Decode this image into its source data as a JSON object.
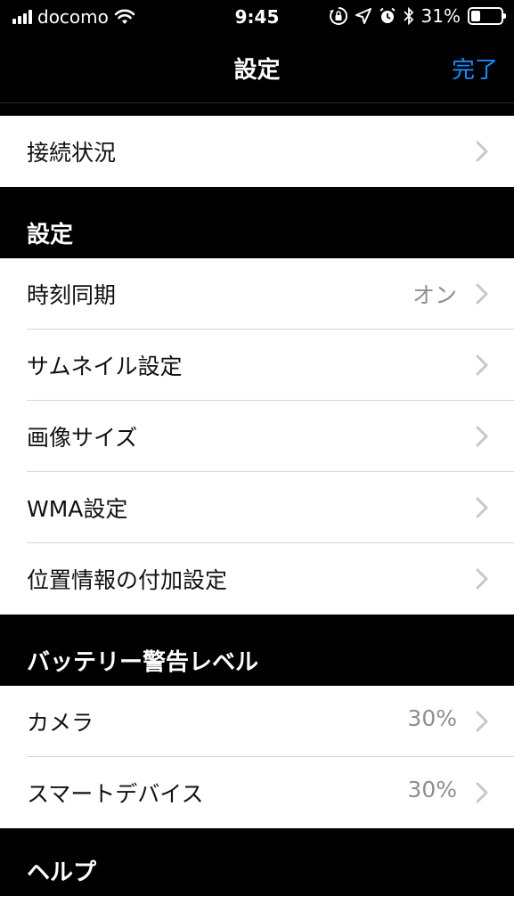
{
  "status_bar": {
    "carrier": "docomo",
    "time": "9:45",
    "battery_percent_label": "31%",
    "battery_level": 0.31
  },
  "nav": {
    "title": "設定",
    "done_label": "完了"
  },
  "sections": {
    "connection": {
      "items": [
        {
          "label": "接続状況",
          "value": ""
        }
      ]
    },
    "settings": {
      "header": "設定",
      "items": [
        {
          "label": "時刻同期",
          "value": "オン"
        },
        {
          "label": "サムネイル設定",
          "value": ""
        },
        {
          "label": "画像サイズ",
          "value": ""
        },
        {
          "label": "WMA設定",
          "value": ""
        },
        {
          "label": "位置情報の付加設定",
          "value": ""
        }
      ]
    },
    "battery_warning": {
      "header": "バッテリー警告レベル",
      "items": [
        {
          "label": "カメラ",
          "value": "30%"
        },
        {
          "label": "スマートデバイス",
          "value": "30%"
        }
      ]
    },
    "help": {
      "header": "ヘルプ"
    }
  },
  "colors": {
    "background": "#000000",
    "row_background": "#ffffff",
    "accent": "#1a8cff",
    "secondary_text": "#8e8e93",
    "chevron": "#c7c7cc"
  },
  "icons": [
    "wifi-icon",
    "orientation-lock-icon",
    "location-arrow-icon",
    "alarm-icon",
    "bluetooth-icon",
    "battery-icon",
    "chevron-right-icon"
  ]
}
